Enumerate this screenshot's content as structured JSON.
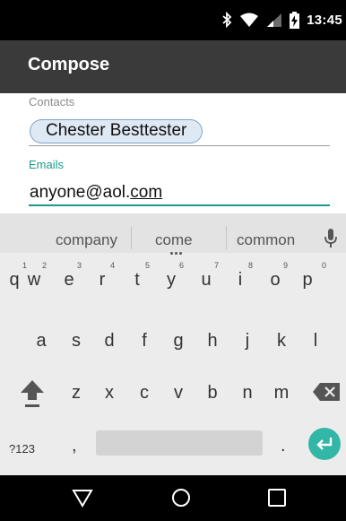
{
  "status_bar": {
    "time": "13:45",
    "icons": [
      "bluetooth-icon",
      "wifi-icon",
      "cell-signal-icon",
      "battery-charging-icon"
    ]
  },
  "app_bar": {
    "title": "Compose"
  },
  "form": {
    "contacts_label": "Contacts",
    "contact_chip": "Chester Besttester",
    "emails_label": "Emails",
    "email_prefix": "anyone@aol.",
    "email_underlined": "com"
  },
  "keyboard": {
    "suggestions": [
      "company",
      "come",
      "common"
    ],
    "row1": [
      {
        "key": "q",
        "hint": "1"
      },
      {
        "key": "w",
        "hint": "2"
      },
      {
        "key": "e",
        "hint": "3"
      },
      {
        "key": "r",
        "hint": "4"
      },
      {
        "key": "t",
        "hint": "5"
      },
      {
        "key": "y",
        "hint": "6"
      },
      {
        "key": "u",
        "hint": "7"
      },
      {
        "key": "i",
        "hint": "8"
      },
      {
        "key": "o",
        "hint": "9"
      },
      {
        "key": "p",
        "hint": "0"
      }
    ],
    "row2": [
      "a",
      "s",
      "d",
      "f",
      "g",
      "h",
      "j",
      "k",
      "l"
    ],
    "row3": [
      "z",
      "x",
      "c",
      "v",
      "b",
      "n",
      "m"
    ],
    "symbols_label": "?123",
    "comma": ",",
    "period": "."
  },
  "nav_bar": {
    "buttons": [
      "back-icon",
      "home-icon",
      "recents-icon"
    ]
  },
  "colors": {
    "accent": "#1a9a8c",
    "enter_key": "#32b6a6",
    "app_bar": "#3a3a3a",
    "chip_bg": "#dfe9f3"
  }
}
